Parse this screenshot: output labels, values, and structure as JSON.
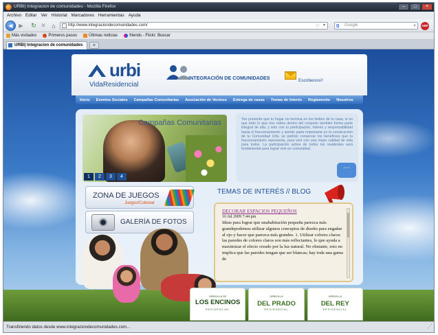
{
  "browser": {
    "window_title": "URBI| Integracion de comunidades - Mozilla Firefox",
    "menu": [
      "Archivo",
      "Editar",
      "Ver",
      "Historial",
      "Marcadores",
      "Herramientas",
      "Ayuda"
    ],
    "url": "http://www.integraciondecomunidades.com/",
    "search_placeholder": "Google",
    "adblock_label": "ABP",
    "bookmarks": [
      "Más visitados",
      "Primeros pasos",
      "Últimas noticias",
      "friends - Flickr: Buscar"
    ],
    "tab_title": "URBI| Integracion de comunidades",
    "status": "Transfiriendo datos desde www.integraciondecomunidades.com..."
  },
  "site": {
    "logo_word": "urbi",
    "logo_sub": "VidaResidencial",
    "header_tagline": "INTEGRACIÓN DE COMUNIDADES",
    "contact": "Escribenos!!",
    "nav": [
      "Inicio",
      "Eventos Sociales",
      "Campañas Comunitarias",
      "Asociación de Vecinos",
      "Entrega de casas",
      "Temas de Interés",
      "Reglamento",
      "Nosotros"
    ],
    "slider": {
      "title": "Campañas Comunitarias",
      "pages": [
        "1",
        "2",
        "3",
        "4"
      ]
    },
    "intro_text": "Ten presente que tu hogar no termina en los limites de tu casa, si no que todo lo que nos rodea dentro del conjunto también forma parte integral de ella, y solo con tu participación, interés y responsabilidad hacia el fraccionamiento y siendo parte importante en la construcción de tu Comunidad Urbi, se podrán conservar los beneficios que tu fraccionamiento representa, para vivir con una mejor calidad de vida para todos. La participación activa de todos los residentes será fundamental para lograr vivir en comunidad.",
    "promos": {
      "juegos_title": "ZONA DE JUEGOS",
      "juegos_sub": "Juegos/Colorear",
      "galeria_title": "GALERÍA DE FOTOS"
    },
    "blog": {
      "heading": "TEMAS DE INTERÉS // BLOG",
      "post_title": "DECORAR ESPACIOS PEQUEÑOS",
      "post_date": "16 Jul 2009 7:44 pm",
      "post_body": "Ideas para lograr que unahabitación pequeña parezca más grandepodemos utilizar algunos conceptos de diseño para engañar al ojo y hacer que parezca más grandes. 1. Utilizar colores claros: las paredes de colores claros son más reflectantes, lo que ayuda a maximizar el efecto creado por la luz natural. No obstante, esto no implica que las paredes tengan que ser blancas; hay toda una gama de"
    },
    "brands": [
      {
        "small": "URBIVILLA DE",
        "name": "LOS ENCINOS",
        "tag": "RESIDENCIAL"
      },
      {
        "small": "URBIVILLA",
        "name": "DEL PRADO",
        "tag": "RESIDENCIAL"
      },
      {
        "small": "URBIVILLA",
        "name": "DEL REY",
        "tag": "RESIDENCIAL"
      }
    ]
  }
}
